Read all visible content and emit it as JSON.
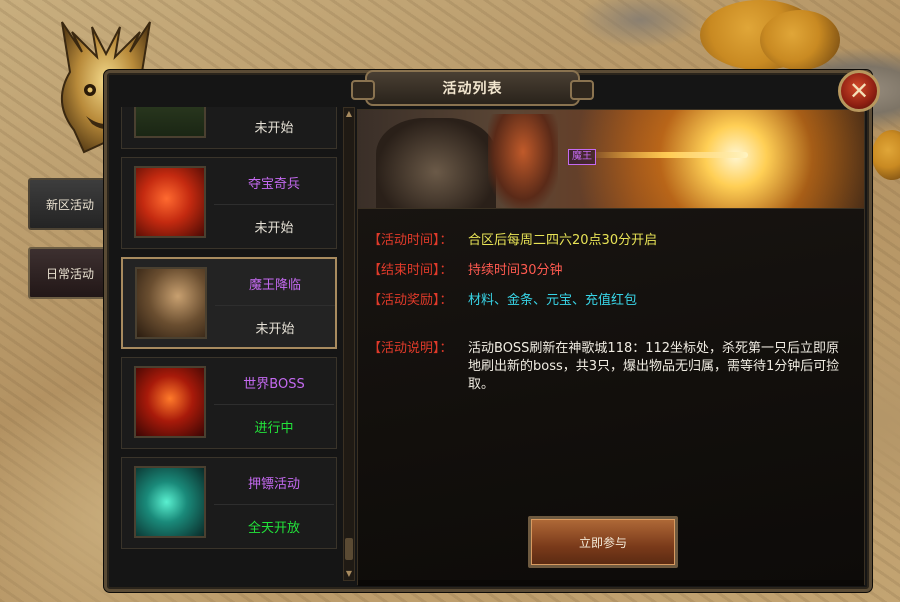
{
  "window": {
    "title": "活动列表"
  },
  "side_tabs": [
    {
      "label": "新区活动"
    },
    {
      "label": "日常活动"
    }
  ],
  "activities": [
    {
      "name": "",
      "status": "未开始",
      "status_color": "#e6e1d6",
      "icon": "treasure-chest-icon"
    },
    {
      "name": "夺宝奇兵",
      "status": "未开始",
      "status_color": "#e6e1d6",
      "icon": "flexing-arm-icon"
    },
    {
      "name": "魔王降临",
      "status": "未开始",
      "status_color": "#e6e1d6",
      "icon": "demon-king-icon",
      "selected": true
    },
    {
      "name": "世界BOSS",
      "status": "进行中",
      "status_color": "#22e33a",
      "icon": "boss-face-icon"
    },
    {
      "name": "押镖活动",
      "status": "全天开放",
      "status_color": "#22e33a",
      "icon": "escort-claw-icon"
    }
  ],
  "detail": {
    "banner_tag": "魔王",
    "time_label": "【活动时间】",
    "time_value": "合区后每周二四六20点30分开启",
    "end_label": "【结束时间】",
    "end_value": "持续时间30分钟",
    "reward_label": "【活动奖励】",
    "reward_value": "材料、金条、元宝、充值红包",
    "desc_label": "【活动说明】",
    "desc_value": "活动BOSS刷新在神歌城118：112坐标处，杀死第一只后立即原地刷出新的boss，共3只，爆出物品无归属，需等待1分钟后可捡取。",
    "join_button": "立即参与"
  },
  "colors": {
    "name_purple": "#c46af0",
    "label_red": "#e03a2a",
    "time_yellow": "#e8e356",
    "end_red": "#ff5a50",
    "reward_cyan": "#38d4e6",
    "status_green": "#22e33a"
  }
}
